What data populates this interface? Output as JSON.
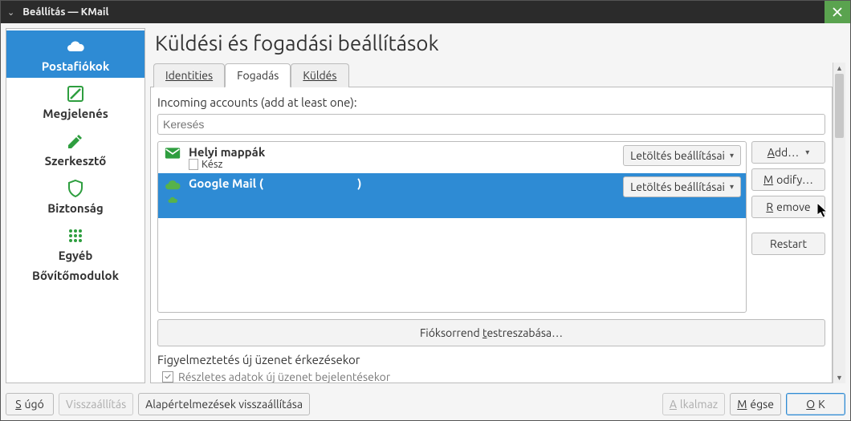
{
  "window": {
    "title": "Beállítás — KMail"
  },
  "sidebar": {
    "items": [
      {
        "id": "accounts",
        "label": "Postafiókok"
      },
      {
        "id": "appearance",
        "label": "Megjelenés"
      },
      {
        "id": "composer",
        "label": "Szerkesztő"
      },
      {
        "id": "security",
        "label": "Biztonság"
      },
      {
        "id": "misc",
        "label": "Egyéb"
      },
      {
        "id": "plugins",
        "label": "Bővítőmodulok"
      }
    ]
  },
  "page": {
    "title": "Küldési és fogadási beállítások"
  },
  "tabs": {
    "identities": "Identities",
    "receiving": "Fogadás",
    "sending": "Küldés"
  },
  "receiving": {
    "section_label": "Incoming accounts (add at least one):",
    "search_placeholder": "Keresés",
    "download_settings_label": "Letöltés beállításai",
    "accounts": [
      {
        "name": "Helyi mappák",
        "status": "Kész",
        "selected": false,
        "icon": "mail"
      },
      {
        "name": "Google Mail (                                 )",
        "status": "",
        "selected": true,
        "icon": "cloud"
      }
    ],
    "buttons": {
      "add": "Add…",
      "modify": "Modify…",
      "remove": "Remove",
      "restart": "Restart"
    },
    "customize_order": "Fióksorrend testreszabása…",
    "notify_section": "Figyelmeztetés új üzenet érkezésekor",
    "detailed_checkbox": "Részletes adatok új üzenet bejelentésekor"
  },
  "footer": {
    "help": "Súgó",
    "reset": "Visszaállítás",
    "defaults": "Alapértelmezések visszaállítása",
    "apply": "Alkalmaz",
    "cancel": "Mégse",
    "ok": "OK"
  }
}
